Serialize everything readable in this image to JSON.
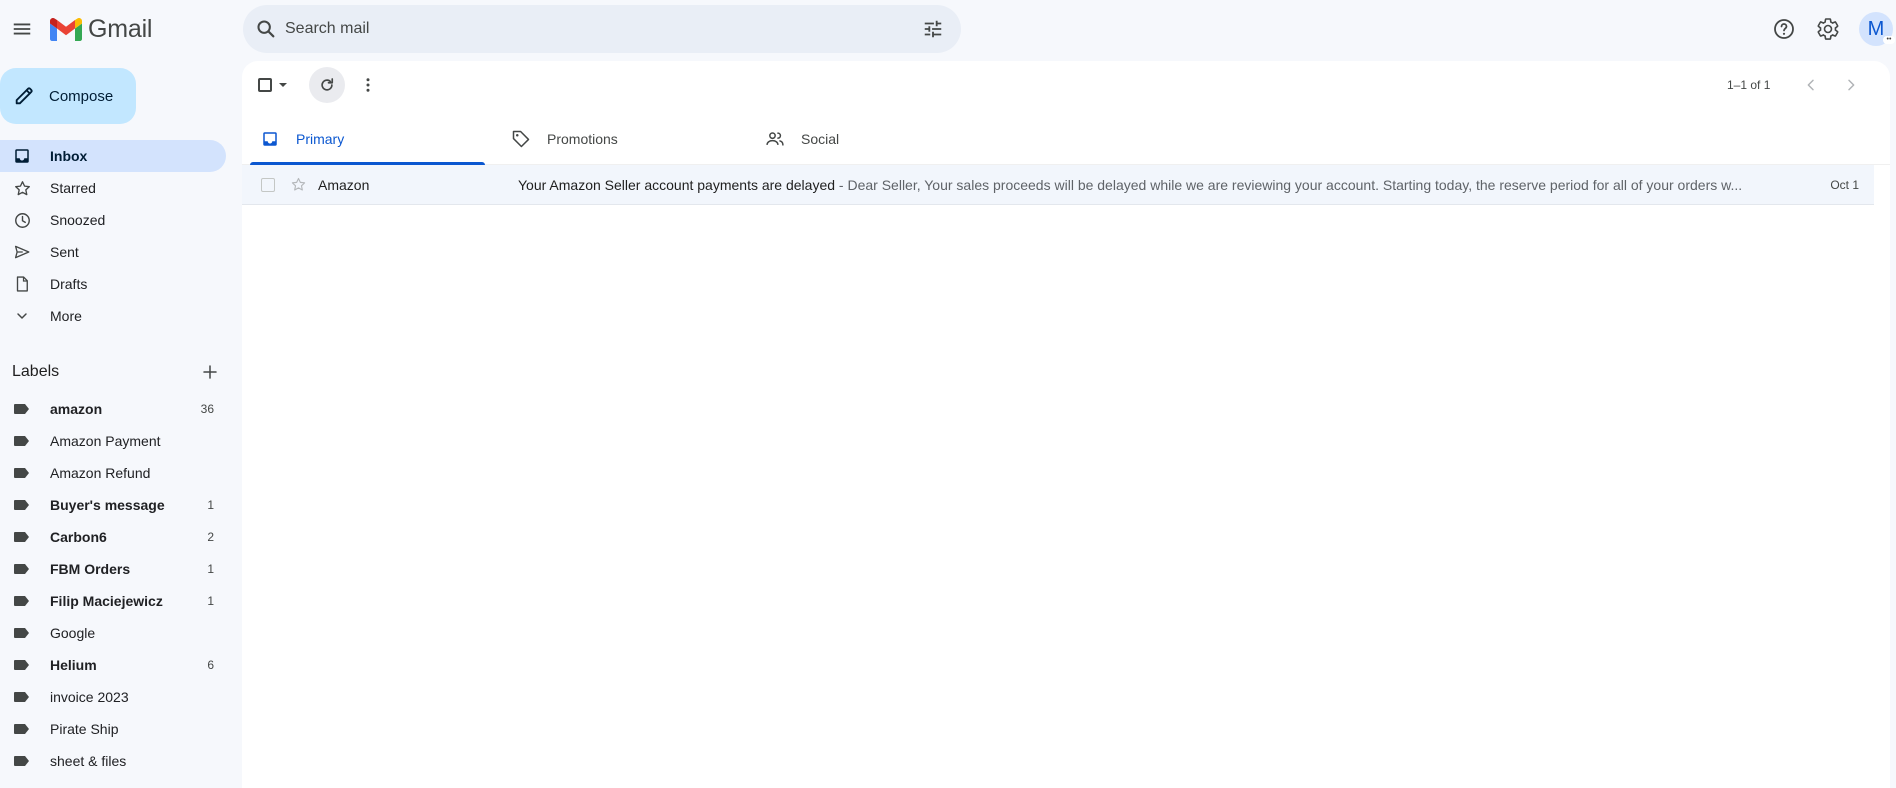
{
  "header": {
    "app_name": "Gmail",
    "search_placeholder": "Search mail",
    "avatar_initial": "M"
  },
  "compose_label": "Compose",
  "nav": [
    {
      "label": "Inbox",
      "icon": "inbox-icon",
      "active": true
    },
    {
      "label": "Starred",
      "icon": "star-icon"
    },
    {
      "label": "Snoozed",
      "icon": "clock-icon"
    },
    {
      "label": "Sent",
      "icon": "send-icon"
    },
    {
      "label": "Drafts",
      "icon": "draft-icon"
    },
    {
      "label": "More",
      "icon": "chevron-down-icon"
    }
  ],
  "labels_title": "Labels",
  "labels": [
    {
      "name": "amazon",
      "count": "36",
      "bold": true
    },
    {
      "name": "Amazon Payment",
      "count": "",
      "bold": false
    },
    {
      "name": "Amazon Refund",
      "count": "",
      "bold": false
    },
    {
      "name": "Buyer's message",
      "count": "1",
      "bold": true
    },
    {
      "name": "Carbon6",
      "count": "2",
      "bold": true
    },
    {
      "name": "FBM Orders",
      "count": "1",
      "bold": true
    },
    {
      "name": "Filip Maciejewicz",
      "count": "1",
      "bold": true
    },
    {
      "name": "Google",
      "count": "",
      "bold": false
    },
    {
      "name": "Helium",
      "count": "6",
      "bold": true
    },
    {
      "name": "invoice 2023",
      "count": "",
      "bold": false
    },
    {
      "name": "Pirate Ship",
      "count": "",
      "bold": false
    },
    {
      "name": "sheet & files",
      "count": "",
      "bold": false
    }
  ],
  "toolbar": {
    "page_count": "1–1 of 1"
  },
  "tabs": [
    {
      "label": "Primary",
      "icon": "inbox-tab-icon",
      "active": true
    },
    {
      "label": "Promotions",
      "icon": "tag-icon"
    },
    {
      "label": "Social",
      "icon": "people-icon"
    }
  ],
  "emails": [
    {
      "sender": "Amazon",
      "subject": "Your Amazon Seller account payments are delayed",
      "separator": " - ",
      "snippet": "Dear Seller, Your sales proceeds will be delayed while we are reviewing your account. Starting today, the reserve period for all of your orders w...",
      "date": "Oct 1",
      "unread": false
    }
  ],
  "colors": {
    "accent": "#0b57d0",
    "compose_bg": "#c2e7ff",
    "active_nav_bg": "#d3e3fd",
    "page_bg": "#f6f8fc"
  }
}
